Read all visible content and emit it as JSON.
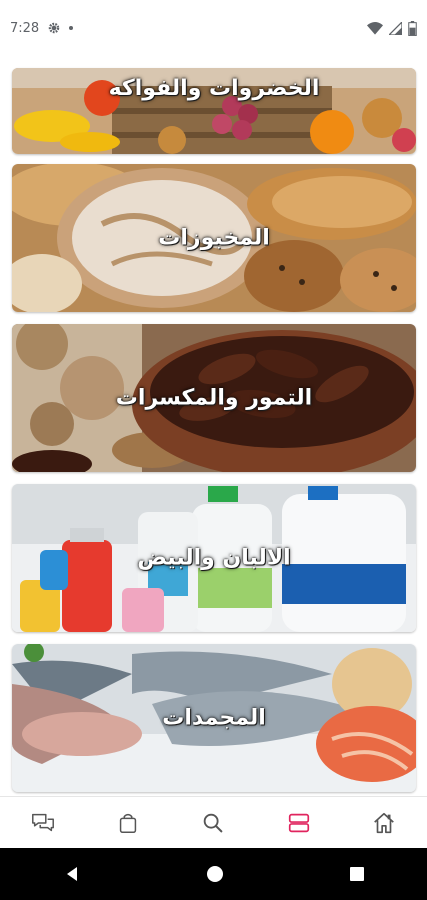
{
  "status_bar": {
    "time": "7:28",
    "icons": [
      "settings-icon",
      "notification-dot",
      "wifi-icon",
      "signal-icon",
      "battery-icon"
    ]
  },
  "categories": [
    {
      "label": "الخضروات والفواكه"
    },
    {
      "label": "المخبوزات"
    },
    {
      "label": "التمور والمكسرات"
    },
    {
      "label": "الالبان والبيض"
    },
    {
      "label": "المجمدات"
    }
  ],
  "bottom_nav": {
    "items": [
      {
        "icon": "chat-icon"
      },
      {
        "icon": "shopping-bag-icon"
      },
      {
        "icon": "search-icon"
      },
      {
        "icon": "categories-icon",
        "active": true
      },
      {
        "icon": "home-icon"
      }
    ],
    "active_color": "#e0245e",
    "inactive_color": "#555555"
  }
}
